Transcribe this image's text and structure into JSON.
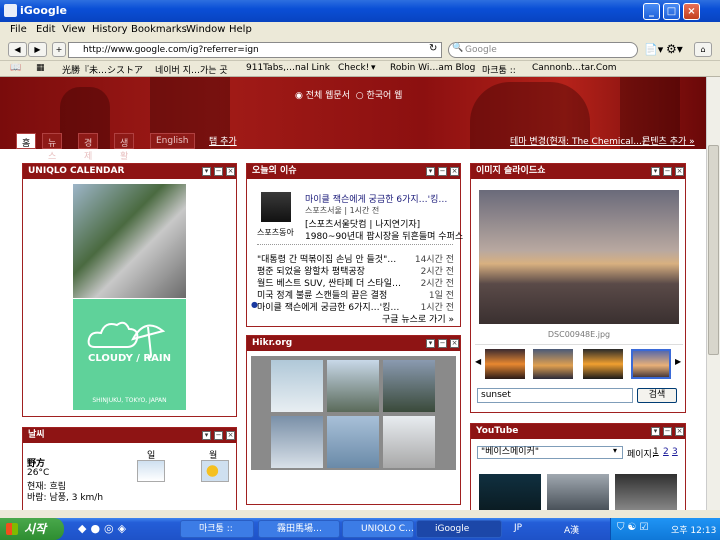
{
  "window": {
    "title": "iGoogle",
    "controls": [
      "minimize",
      "maximize",
      "close"
    ]
  },
  "menu": [
    "File",
    "Edit",
    "View",
    "History",
    "Bookmarks",
    "Window",
    "Help"
  ],
  "toolbar": {
    "url": "http://www.google.com/ig?referrer=ign",
    "search_placeholder": "Google"
  },
  "bookmarks": [
    "光勝『未…シストア",
    "네이버 지…가는 곳",
    "911Tabs,…nal Link",
    "Check!",
    "Robin Wi…am Blog",
    "마크툼 ::",
    "Cannonb…tar.Com"
  ],
  "header": {
    "radio_all": "전체 웹문서",
    "radio_korean": "한국어 웹",
    "tabs": [
      "홈",
      "뉴스",
      "경제",
      "생활",
      "English"
    ],
    "add_tab": "탭 추가",
    "theme_link": "테마 변경(현재: The Chemical...)",
    "add_content": "콘텐츠 추가 »"
  },
  "uniqlo": {
    "title": "UNIQLO CALENDAR",
    "weather": "CLOUDY / RAIN",
    "location": "SHINJUKU, TOKYO, JAPAN"
  },
  "news": {
    "title": "오늘의 이슈",
    "featured_headline": "마이클 잭슨에게 궁금한 6가지…'킹…",
    "featured_source": "스포츠서울 | 1시간 전",
    "featured_thumb_caption": "스포츠동아",
    "sub_headline": "[스포츠서울닷컴 | 나지연기자]",
    "sub_body": "1980~90년대 팝시장을 뒤흔들며 수퍼스",
    "items": [
      {
        "text": "\"대통령 간 떡볶이집 손님 안 들것\"…",
        "time": "14시간 전"
      },
      {
        "text": "평준 되었을 왕할차 평택공장",
        "time": "2시간 전"
      },
      {
        "text": "월드 베스트 SUV, 싼타페 더 스타일…",
        "time": "2시간 전"
      },
      {
        "text": "미국 정계 불륜 스캔들의 끝은 결정",
        "time": "1일 전"
      },
      {
        "text": "마이클 잭슨에게 궁금한 6가지…'킹…",
        "time": "1시간 전"
      }
    ],
    "more": "구글 뉴스로 가기 »"
  },
  "slideshow": {
    "title": "이미지 슬라이드쇼",
    "caption": "DSC00948E.jpg",
    "search_value": "sunset",
    "search_button": "검색"
  },
  "hikr": {
    "title": "Hikr.org"
  },
  "weather": {
    "title": "날씨",
    "city": "野方",
    "temp": "26°C",
    "condition": "현재: 흐림",
    "wind": "바람: 남풍, 3 km/h",
    "days": [
      "일",
      "월"
    ]
  },
  "youtube": {
    "title": "YouTube",
    "dropdown": "\"베이스메이커\"",
    "page_label": "페이지:",
    "pages": [
      "1",
      "2",
      "3"
    ]
  },
  "taskbar": {
    "start": "시작",
    "tasks": [
      "마크툼 ::",
      "霧田馬場…",
      "UNIQLO C…",
      "iGoogle"
    ],
    "lang": "JP",
    "ime": "A漢",
    "clock": "오후 12:13"
  }
}
